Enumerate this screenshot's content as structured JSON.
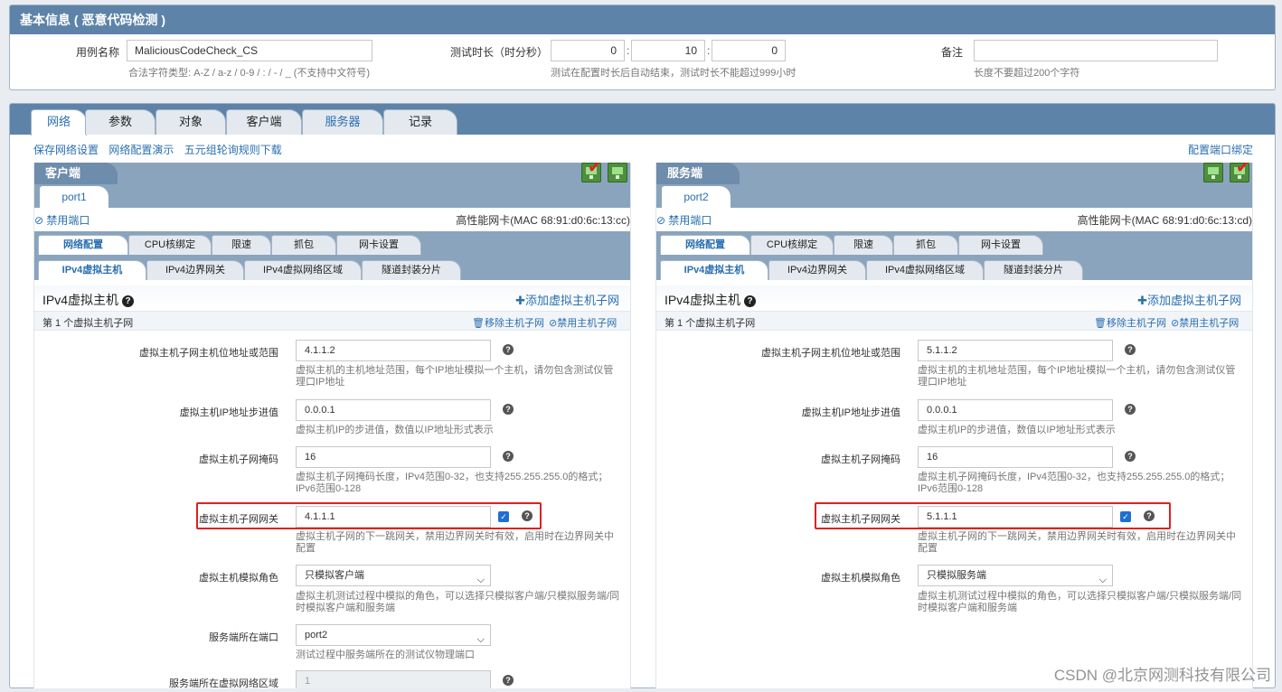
{
  "basic": {
    "title": "基本信息 ( 恶意代码检测 )",
    "case_name_label": "用例名称",
    "case_name_value": "MaliciousCodeCheck_CS",
    "case_name_hint": "合法字符类型: A-Z / a-z / 0-9 / : / - / _ (不支持中文符号)",
    "duration_label": "测试时长（时分秒）",
    "duration_h": "0",
    "duration_m": "10",
    "duration_s": "0",
    "colon": ":",
    "duration_hint": "测试在配置时长后自动结束，测试时长不能超过999小时",
    "remark_label": "备注",
    "remark_value": "",
    "remark_hint": "长度不要超过200个字符"
  },
  "main_tabs": [
    "网络",
    "参数",
    "对象",
    "客户端",
    "服务器",
    "记录"
  ],
  "links": [
    "保存网络设置",
    "网络配置演示",
    "五元组轮询规则下载"
  ],
  "port_bind_link": "配置端口绑定",
  "client": {
    "title": "客户端",
    "port": "port1",
    "disable_port": "禁用端口",
    "nic": "高性能网卡(MAC 68:91:d0:6c:13:cc)",
    "sub_tabs_1": [
      "网络配置",
      "CPU核绑定",
      "限速",
      "抓包",
      "网卡设置"
    ],
    "sub_tabs_2": [
      "IPv4虚拟主机",
      "IPv4边界网关",
      "IPv4虚拟网络区域",
      "隧道封装分片"
    ],
    "section_title": "IPv4虚拟主机",
    "add_subnet": "添加虚拟主机子网",
    "subnet_title": "第 1 个虚拟主机子网",
    "remove_subnet": "移除主机子网",
    "disable_subnet": "禁用主机子网",
    "f1_label": "虚拟主机子网主机位地址或范围",
    "f1_value": "4.1.1.2",
    "f1_hint": "虚拟主机的主机地址范围，每个IP地址模拟一个主机，请勿包含测试仪管理口IP地址",
    "f2_label": "虚拟主机IP地址步进值",
    "f2_value": "0.0.0.1",
    "f2_hint": "虚拟主机IP的步进值，数值以IP地址形式表示",
    "f3_label": "虚拟主机子网掩码",
    "f3_value": "16",
    "f3_hint": "虚拟主机子网掩码长度，IPv4范围0-32，也支持255.255.255.0的格式；IPv6范围0-128",
    "f4_label": "虚拟主机子网网关",
    "f4_value": "4.1.1.1",
    "f4_hint": "虚拟主机子网的下一跳网关，禁用边界网关时有效，启用时在边界网关中配置",
    "f5_label": "虚拟主机模拟角色",
    "f5_value": "只模拟客户端",
    "f5_hint": "虚拟主机测试过程中模拟的角色，可以选择只模拟客户端/只模拟服务端/同时模拟客户端和服务端",
    "f6_label": "服务端所在端口",
    "f6_value": "port2",
    "f6_hint": "测试过程中服务端所在的测试仪物理端口",
    "f7_label": "服务端所在虚拟网络区域",
    "f7_value": "1"
  },
  "server": {
    "title": "服务端",
    "port": "port2",
    "disable_port": "禁用端口",
    "nic": "高性能网卡(MAC 68:91:d0:6c:13:cd)",
    "sub_tabs_1": [
      "网络配置",
      "CPU核绑定",
      "限速",
      "抓包",
      "网卡设置"
    ],
    "sub_tabs_2": [
      "IPv4虚拟主机",
      "IPv4边界网关",
      "IPv4虚拟网络区域",
      "隧道封装分片"
    ],
    "section_title": "IPv4虚拟主机",
    "add_subnet": "添加虚拟主机子网",
    "subnet_title": "第 1 个虚拟主机子网",
    "remove_subnet": "移除主机子网",
    "disable_subnet": "禁用主机子网",
    "f1_label": "虚拟主机子网主机位地址或范围",
    "f1_value": "5.1.1.2",
    "f1_hint": "虚拟主机的主机地址范围，每个IP地址模拟一个主机，请勿包含测试仪管理口IP地址",
    "f2_label": "虚拟主机IP地址步进值",
    "f2_value": "0.0.0.1",
    "f2_hint": "虚拟主机IP的步进值，数值以IP地址形式表示",
    "f3_label": "虚拟主机子网掩码",
    "f3_value": "16",
    "f3_hint": "虚拟主机子网掩码长度，IPv4范围0-32，也支持255.255.255.0的格式；IPv6范围0-128",
    "f4_label": "虚拟主机子网网关",
    "f4_value": "5.1.1.1",
    "f4_hint": "虚拟主机子网的下一跳网关，禁用边界网关时有效，启用时在边界网关中配置",
    "f5_label": "虚拟主机模拟角色",
    "f5_value": "只模拟服务端",
    "f5_hint": "虚拟主机测试过程中模拟的角色，可以选择只模拟客户端/只模拟服务端/同时模拟客户端和服务端"
  },
  "watermark": "CSDN @北京网测科技有限公司",
  "colors": {
    "header_blue": "#5d83a8",
    "sub_blue": "#8ba4bd",
    "link_blue": "#2a6fb0",
    "highlight_red": "#e02020"
  }
}
